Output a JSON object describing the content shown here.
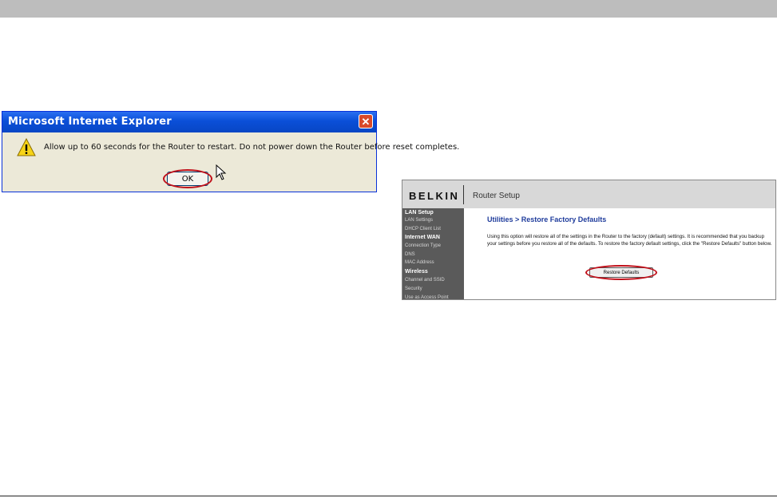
{
  "dialog": {
    "title": "Microsoft Internet Explorer",
    "close_glyph": "✕",
    "message": "Allow up to 60 seconds for the Router to restart. Do not power down the Router before reset completes.",
    "ok_label": "OK"
  },
  "router": {
    "brand": "BELKIN",
    "subtitle": "Router Setup",
    "sidebar": [
      {
        "label": "LAN Setup",
        "header": true
      },
      {
        "label": "LAN Settings",
        "header": false
      },
      {
        "label": "DHCP Client List",
        "header": false
      },
      {
        "label": "Internet WAN",
        "header": true
      },
      {
        "label": "Connection Type",
        "header": false
      },
      {
        "label": "DNS",
        "header": false
      },
      {
        "label": "MAC Address",
        "header": false
      },
      {
        "label": "Wireless",
        "header": true
      },
      {
        "label": "Channel and SSID",
        "header": false
      },
      {
        "label": "Security",
        "header": false
      },
      {
        "label": "Use as Access Point",
        "header": false
      }
    ],
    "heading": "Utilities > Restore Factory Defaults",
    "body": "Using this option will restore all of the settings in the Router to the factory (default) settings. It is recommended that you backup your settings before you restore all of the defaults. To restore the factory default settings, click the \"Restore Defaults\" button below.",
    "button_label": "Restore Defaults"
  },
  "colors": {
    "highlight_ring": "#c0101a",
    "xp_titlebar": "#0a4fd8",
    "belkin_heading": "#1f3c9c"
  }
}
